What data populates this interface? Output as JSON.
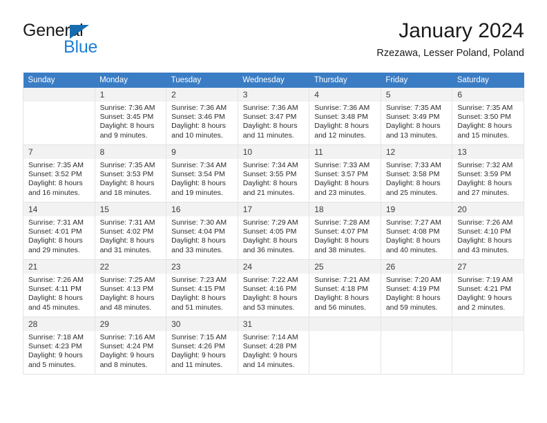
{
  "brand": {
    "name_part1": "General",
    "name_part2": "Blue",
    "triangle_color": "#156cb0",
    "blue_color": "#1f7fd4"
  },
  "header": {
    "title": "January 2024",
    "subtitle": "Rzezawa, Lesser Poland, Poland"
  },
  "theme": {
    "header_bg": "#3b7dc4",
    "daynum_bg": "#f2f2f2",
    "grid_border": "#e3e3e3"
  },
  "weekday_headers": [
    "Sunday",
    "Monday",
    "Tuesday",
    "Wednesday",
    "Thursday",
    "Friday",
    "Saturday"
  ],
  "weeks": [
    [
      {
        "day": "",
        "empty": true
      },
      {
        "day": "1",
        "sunrise": "Sunrise: 7:36 AM",
        "sunset": "Sunset: 3:45 PM",
        "daylight1": "Daylight: 8 hours",
        "daylight2": "and 9 minutes."
      },
      {
        "day": "2",
        "sunrise": "Sunrise: 7:36 AM",
        "sunset": "Sunset: 3:46 PM",
        "daylight1": "Daylight: 8 hours",
        "daylight2": "and 10 minutes."
      },
      {
        "day": "3",
        "sunrise": "Sunrise: 7:36 AM",
        "sunset": "Sunset: 3:47 PM",
        "daylight1": "Daylight: 8 hours",
        "daylight2": "and 11 minutes."
      },
      {
        "day": "4",
        "sunrise": "Sunrise: 7:36 AM",
        "sunset": "Sunset: 3:48 PM",
        "daylight1": "Daylight: 8 hours",
        "daylight2": "and 12 minutes."
      },
      {
        "day": "5",
        "sunrise": "Sunrise: 7:35 AM",
        "sunset": "Sunset: 3:49 PM",
        "daylight1": "Daylight: 8 hours",
        "daylight2": "and 13 minutes."
      },
      {
        "day": "6",
        "sunrise": "Sunrise: 7:35 AM",
        "sunset": "Sunset: 3:50 PM",
        "daylight1": "Daylight: 8 hours",
        "daylight2": "and 15 minutes."
      }
    ],
    [
      {
        "day": "7",
        "sunrise": "Sunrise: 7:35 AM",
        "sunset": "Sunset: 3:52 PM",
        "daylight1": "Daylight: 8 hours",
        "daylight2": "and 16 minutes."
      },
      {
        "day": "8",
        "sunrise": "Sunrise: 7:35 AM",
        "sunset": "Sunset: 3:53 PM",
        "daylight1": "Daylight: 8 hours",
        "daylight2": "and 18 minutes."
      },
      {
        "day": "9",
        "sunrise": "Sunrise: 7:34 AM",
        "sunset": "Sunset: 3:54 PM",
        "daylight1": "Daylight: 8 hours",
        "daylight2": "and 19 minutes."
      },
      {
        "day": "10",
        "sunrise": "Sunrise: 7:34 AM",
        "sunset": "Sunset: 3:55 PM",
        "daylight1": "Daylight: 8 hours",
        "daylight2": "and 21 minutes."
      },
      {
        "day": "11",
        "sunrise": "Sunrise: 7:33 AM",
        "sunset": "Sunset: 3:57 PM",
        "daylight1": "Daylight: 8 hours",
        "daylight2": "and 23 minutes."
      },
      {
        "day": "12",
        "sunrise": "Sunrise: 7:33 AM",
        "sunset": "Sunset: 3:58 PM",
        "daylight1": "Daylight: 8 hours",
        "daylight2": "and 25 minutes."
      },
      {
        "day": "13",
        "sunrise": "Sunrise: 7:32 AM",
        "sunset": "Sunset: 3:59 PM",
        "daylight1": "Daylight: 8 hours",
        "daylight2": "and 27 minutes."
      }
    ],
    [
      {
        "day": "14",
        "sunrise": "Sunrise: 7:31 AM",
        "sunset": "Sunset: 4:01 PM",
        "daylight1": "Daylight: 8 hours",
        "daylight2": "and 29 minutes."
      },
      {
        "day": "15",
        "sunrise": "Sunrise: 7:31 AM",
        "sunset": "Sunset: 4:02 PM",
        "daylight1": "Daylight: 8 hours",
        "daylight2": "and 31 minutes."
      },
      {
        "day": "16",
        "sunrise": "Sunrise: 7:30 AM",
        "sunset": "Sunset: 4:04 PM",
        "daylight1": "Daylight: 8 hours",
        "daylight2": "and 33 minutes."
      },
      {
        "day": "17",
        "sunrise": "Sunrise: 7:29 AM",
        "sunset": "Sunset: 4:05 PM",
        "daylight1": "Daylight: 8 hours",
        "daylight2": "and 36 minutes."
      },
      {
        "day": "18",
        "sunrise": "Sunrise: 7:28 AM",
        "sunset": "Sunset: 4:07 PM",
        "daylight1": "Daylight: 8 hours",
        "daylight2": "and 38 minutes."
      },
      {
        "day": "19",
        "sunrise": "Sunrise: 7:27 AM",
        "sunset": "Sunset: 4:08 PM",
        "daylight1": "Daylight: 8 hours",
        "daylight2": "and 40 minutes."
      },
      {
        "day": "20",
        "sunrise": "Sunrise: 7:26 AM",
        "sunset": "Sunset: 4:10 PM",
        "daylight1": "Daylight: 8 hours",
        "daylight2": "and 43 minutes."
      }
    ],
    [
      {
        "day": "21",
        "sunrise": "Sunrise: 7:26 AM",
        "sunset": "Sunset: 4:11 PM",
        "daylight1": "Daylight: 8 hours",
        "daylight2": "and 45 minutes."
      },
      {
        "day": "22",
        "sunrise": "Sunrise: 7:25 AM",
        "sunset": "Sunset: 4:13 PM",
        "daylight1": "Daylight: 8 hours",
        "daylight2": "and 48 minutes."
      },
      {
        "day": "23",
        "sunrise": "Sunrise: 7:23 AM",
        "sunset": "Sunset: 4:15 PM",
        "daylight1": "Daylight: 8 hours",
        "daylight2": "and 51 minutes."
      },
      {
        "day": "24",
        "sunrise": "Sunrise: 7:22 AM",
        "sunset": "Sunset: 4:16 PM",
        "daylight1": "Daylight: 8 hours",
        "daylight2": "and 53 minutes."
      },
      {
        "day": "25",
        "sunrise": "Sunrise: 7:21 AM",
        "sunset": "Sunset: 4:18 PM",
        "daylight1": "Daylight: 8 hours",
        "daylight2": "and 56 minutes."
      },
      {
        "day": "26",
        "sunrise": "Sunrise: 7:20 AM",
        "sunset": "Sunset: 4:19 PM",
        "daylight1": "Daylight: 8 hours",
        "daylight2": "and 59 minutes."
      },
      {
        "day": "27",
        "sunrise": "Sunrise: 7:19 AM",
        "sunset": "Sunset: 4:21 PM",
        "daylight1": "Daylight: 9 hours",
        "daylight2": "and 2 minutes."
      }
    ],
    [
      {
        "day": "28",
        "sunrise": "Sunrise: 7:18 AM",
        "sunset": "Sunset: 4:23 PM",
        "daylight1": "Daylight: 9 hours",
        "daylight2": "and 5 minutes."
      },
      {
        "day": "29",
        "sunrise": "Sunrise: 7:16 AM",
        "sunset": "Sunset: 4:24 PM",
        "daylight1": "Daylight: 9 hours",
        "daylight2": "and 8 minutes."
      },
      {
        "day": "30",
        "sunrise": "Sunrise: 7:15 AM",
        "sunset": "Sunset: 4:26 PM",
        "daylight1": "Daylight: 9 hours",
        "daylight2": "and 11 minutes."
      },
      {
        "day": "31",
        "sunrise": "Sunrise: 7:14 AM",
        "sunset": "Sunset: 4:28 PM",
        "daylight1": "Daylight: 9 hours",
        "daylight2": "and 14 minutes."
      },
      {
        "day": "",
        "empty": true
      },
      {
        "day": "",
        "empty": true
      },
      {
        "day": "",
        "empty": true
      }
    ]
  ]
}
